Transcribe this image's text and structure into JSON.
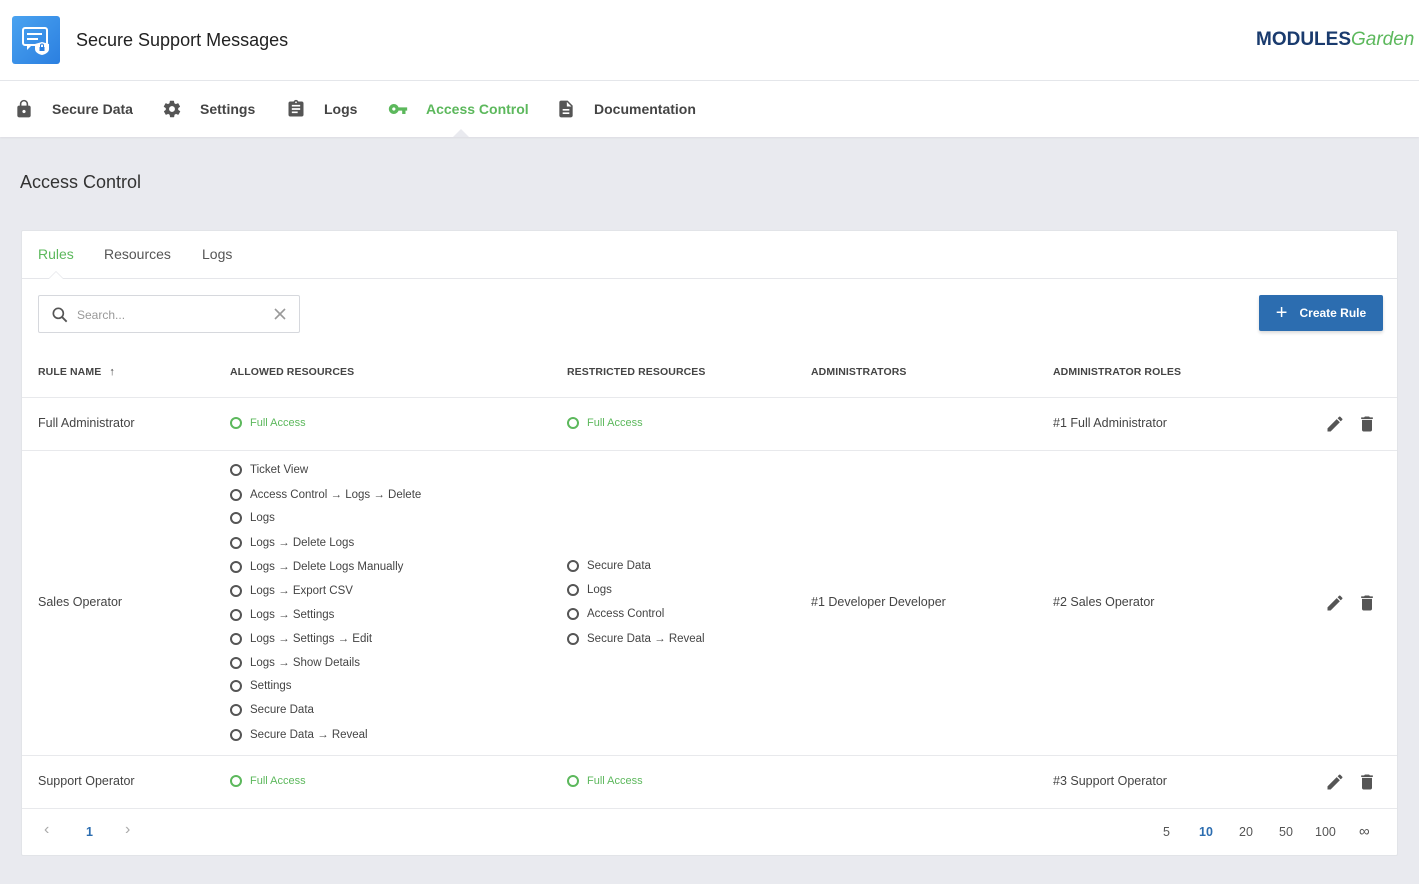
{
  "app": {
    "title": "Secure Support Messages",
    "logo_part1": "MODULES",
    "logo_part2": "Garden",
    "icon": "secure-message-icon"
  },
  "nav": {
    "items": [
      {
        "label": "Secure Data",
        "icon": "lock-icon"
      },
      {
        "label": "Settings",
        "icon": "gear-icon"
      },
      {
        "label": "Logs",
        "icon": "clipboard-icon"
      },
      {
        "label": "Access Control",
        "icon": "key-icon",
        "active": true
      },
      {
        "label": "Documentation",
        "icon": "document-icon"
      }
    ],
    "active_color": "#5cb85c"
  },
  "page": {
    "title": "Access Control"
  },
  "tabs": [
    {
      "label": "Rules",
      "active": true
    },
    {
      "label": "Resources"
    },
    {
      "label": "Logs"
    }
  ],
  "search": {
    "placeholder": "Search...",
    "value": ""
  },
  "create_button": {
    "label": "Create Rule",
    "color": "#2c6db0"
  },
  "table": {
    "headers": [
      "RULE NAME",
      "ALLOWED RESOURCES",
      "RESTRICTED RESOURCES",
      "ADMINISTRATORS",
      "ADMINISTRATOR ROLES"
    ],
    "sort": {
      "column": "RULE NAME",
      "direction": "ascending",
      "indicator": "↑"
    },
    "rows": [
      {
        "name": "Full Administrator",
        "allowed": [
          "Full Access"
        ],
        "restricted": [
          "Full Access"
        ],
        "administrators": "",
        "roles": "#1 Full Administrator"
      },
      {
        "name": "Sales Operator",
        "allowed": [
          "Ticket View",
          "Access Control → Logs → Delete",
          "Logs",
          "Logs → Delete Logs",
          "Logs → Delete Logs Manually",
          "Logs → Export CSV",
          "Logs → Settings",
          "Logs → Settings → Edit",
          "Logs → Show Details",
          "Settings",
          "Secure Data",
          "Secure Data → Reveal"
        ],
        "restricted": [
          "Secure Data",
          "Logs",
          "Access Control",
          "Secure Data → Reveal"
        ],
        "administrators": "#1 Developer Developer",
        "roles": "#2 Sales Operator"
      },
      {
        "name": "Support Operator",
        "allowed": [
          "Full Access"
        ],
        "restricted": [
          "Full Access"
        ],
        "administrators": "",
        "roles": "#3 Support Operator"
      }
    ]
  },
  "pagination": {
    "current_page": "1",
    "prev_icon": "‹",
    "next_icon": "›",
    "page_sizes": [
      "5",
      "10",
      "20",
      "50",
      "100",
      "∞"
    ],
    "active_size": "10"
  }
}
